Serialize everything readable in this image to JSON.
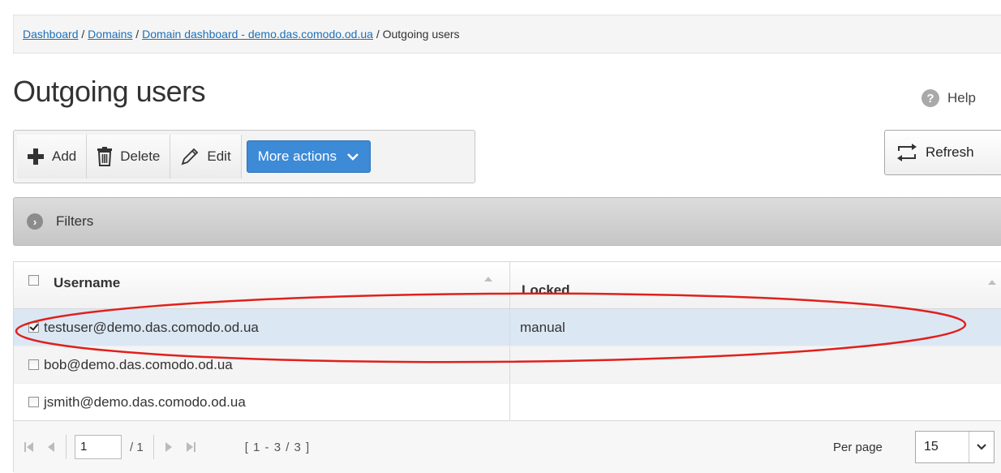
{
  "breadcrumb": {
    "items": [
      "Dashboard",
      "Domains",
      "Domain dashboard - demo.das.comodo.od.ua"
    ],
    "separator": " / ",
    "current": "Outgoing users"
  },
  "page_title": "Outgoing users",
  "help_label": "Help",
  "toolbar": {
    "add_label": "Add",
    "delete_label": "Delete",
    "edit_label": "Edit",
    "more_actions_label": "More actions",
    "refresh_label": "Refresh"
  },
  "filters_label": "Filters",
  "table": {
    "columns": [
      "Username",
      "Locked"
    ],
    "rows": [
      {
        "username": "testuser@demo.das.comodo.od.ua",
        "locked": "manual",
        "checked": true
      },
      {
        "username": "bob@demo.das.comodo.od.ua",
        "locked": "",
        "checked": false
      },
      {
        "username": "jsmith@demo.das.comodo.od.ua",
        "locked": "",
        "checked": false
      }
    ]
  },
  "pager": {
    "page": "1",
    "of": "/ 1",
    "range": "[ 1 - 3 / 3 ]",
    "per_page_label": "Per page",
    "per_page": "15"
  },
  "colors": {
    "accent": "#3d8ad6",
    "selected_row": "#dce7f4",
    "annotation": "#e0201c"
  }
}
